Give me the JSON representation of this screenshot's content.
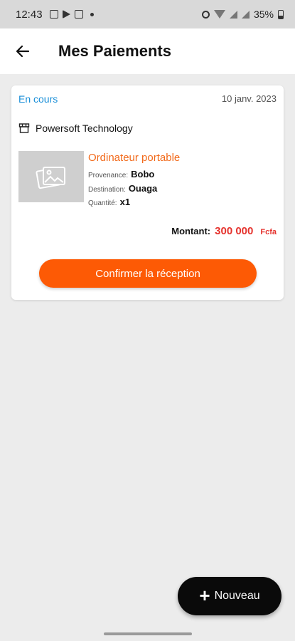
{
  "status_bar": {
    "time": "12:43",
    "battery": "35%"
  },
  "header": {
    "title": "Mes Paiements"
  },
  "card": {
    "status": "En cours",
    "date": "10 janv. 2023",
    "vendor": "Powersoft Technology",
    "product": {
      "name": "Ordinateur portable",
      "provenance_label": "Provenance:",
      "provenance": "Bobo",
      "destination_label": "Destination:",
      "destination": "Ouaga",
      "quantity_label": "Quantité:",
      "quantity": "x1"
    },
    "amount_label": "Montant:",
    "amount": "300 000",
    "currency": "Fcfa",
    "confirm_label": "Confirmer la réception"
  },
  "fab": {
    "label": "Nouveau"
  },
  "colors": {
    "accent": "#fd5a05",
    "status_blue": "#1a8fd8",
    "amount_red": "#e5322d"
  }
}
